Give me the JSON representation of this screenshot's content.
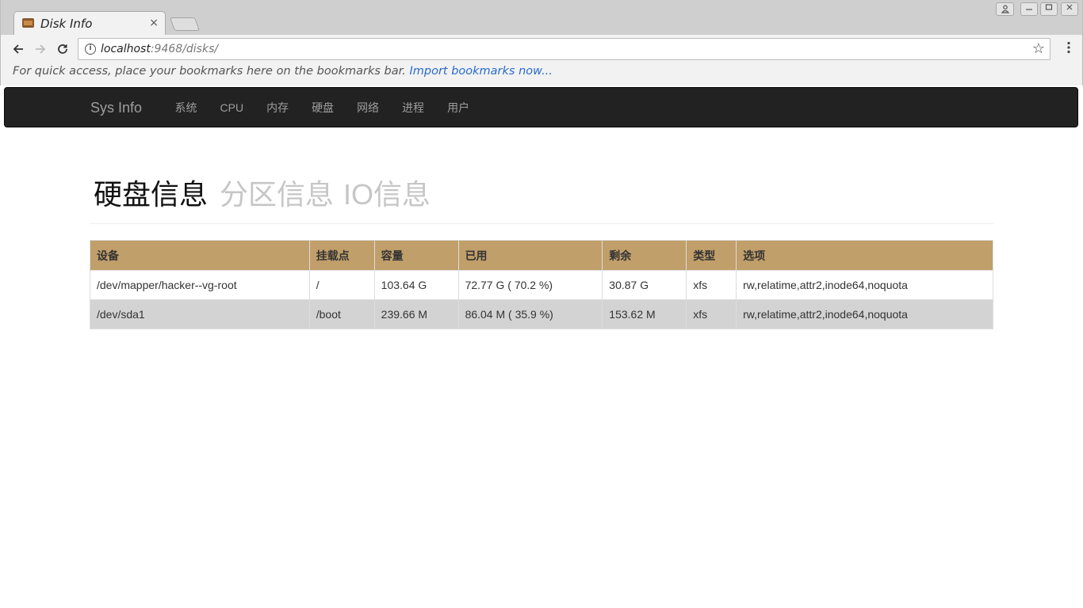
{
  "browser": {
    "tab_title": "Disk Info",
    "tab_close": "×",
    "url_host": "localhost",
    "url_rest": ":9468/disks/",
    "bookmarks_text": "For quick access, place your bookmarks here on the bookmarks bar.",
    "bookmarks_link": "Import bookmarks now...",
    "icons": [
      "back-arrow-icon",
      "forward-arrow-icon",
      "reload-icon",
      "info-icon",
      "star-icon",
      "menu-icon",
      "user-icon",
      "minimize-icon",
      "maximize-icon",
      "close-icon"
    ]
  },
  "navbar": {
    "brand": "Sys Info",
    "links": [
      "系统",
      "CPU",
      "内存",
      "硬盘",
      "网络",
      "进程",
      "用户"
    ]
  },
  "header": {
    "active": "硬盘信息",
    "partitions": "分区信息",
    "io": "IO信息"
  },
  "table": {
    "columns": [
      "设备",
      "挂载点",
      "容量",
      "已用",
      "剩余",
      "类型",
      "选项"
    ],
    "rows": [
      [
        "/dev/mapper/hacker--vg-root",
        "/",
        "103.64 G",
        "72.77 G ( 70.2 %)",
        "30.87 G",
        "xfs",
        "rw,relatime,attr2,inode64,noquota"
      ],
      [
        "/dev/sda1",
        "/boot",
        "239.66 M",
        "86.04 M ( 35.9 %)",
        "153.62 M",
        "xfs",
        "rw,relatime,attr2,inode64,noquota"
      ]
    ]
  },
  "colors": {
    "navbar_bg": "#222222",
    "table_header_bg": "#c19f6a",
    "striped_row_bg": "#d3d3d3",
    "link_blue": "#2a6bcc"
  }
}
